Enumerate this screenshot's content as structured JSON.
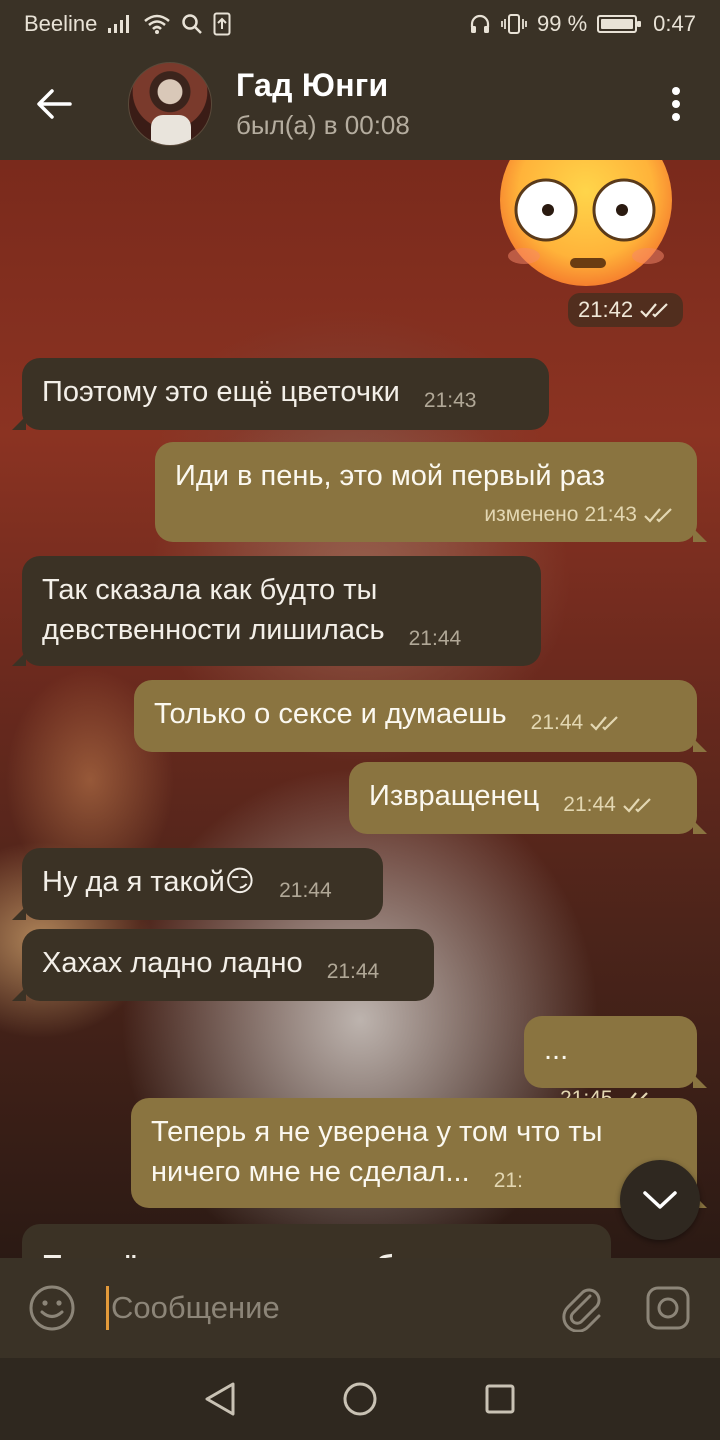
{
  "status_bar": {
    "carrier": "Beeline",
    "battery": "99 %",
    "time": "0:47"
  },
  "header": {
    "name": "Гад Юнги",
    "status": "был(а) в 00:08"
  },
  "sticker": {
    "time": "21:42"
  },
  "messages": [
    {
      "text": "Поэтому это ещё цветочки",
      "time": "21:43"
    },
    {
      "text": "Иди в пень, это мой первый раз",
      "edited": "изменено",
      "time": "21:43"
    },
    {
      "text": "Так сказала как будто ты девственности лишилась",
      "time": "21:44"
    },
    {
      "text": "Только о сексе и думаешь",
      "time": "21:44"
    },
    {
      "text": "Извращенец",
      "time": "21:44"
    },
    {
      "text": "Ну да я такой😏",
      "time": "21:44"
    },
    {
      "text": "Хахах ладно ладно",
      "time": "21:44"
    },
    {
      "text": "...",
      "time": "21:45"
    },
    {
      "text": "Теперь я не уверена у том что ты ничего мне не сделал...",
      "time": "21:"
    },
    {
      "text": "Прошёл месяц их дружбе"
    }
  ],
  "input": {
    "placeholder": "Сообщение"
  },
  "colors": {
    "bar": "#3a3226",
    "incoming": "#3b3225",
    "outgoing": "#8a7440",
    "caret": "#e39a3a"
  }
}
